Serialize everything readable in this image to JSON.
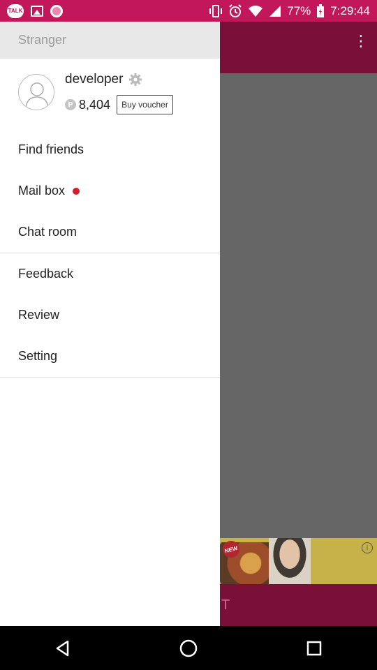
{
  "status_bar": {
    "battery": "77%",
    "time": "7:29:44",
    "notification_icons": [
      "talk-icon",
      "image-icon",
      "record-icon"
    ],
    "system_icons": [
      "vibrate-icon",
      "alarm-icon",
      "wifi-icon",
      "signal-icon",
      "battery-icon"
    ],
    "badge_text": "TALK"
  },
  "drawer": {
    "header": "Stranger",
    "profile": {
      "username": "developer",
      "points_icon": "P",
      "points": "8,404",
      "voucher_button": "Buy voucher"
    },
    "menu": [
      {
        "label": "Find friends"
      },
      {
        "label": "Mail box",
        "badge": "red-dot"
      },
      {
        "label": "Chat room"
      },
      {
        "label": "Feedback"
      },
      {
        "label": "Review"
      },
      {
        "label": "Setting"
      }
    ]
  },
  "background_app": {
    "more_icon": "⋮",
    "banner_badge": "NEW",
    "banner_info": "i",
    "bottom_text": "T"
  },
  "colors": {
    "status_bar": "#c2185b",
    "app_header": "#7a1038",
    "scrim": "#666666",
    "mail_dot": "#d51d2a"
  }
}
